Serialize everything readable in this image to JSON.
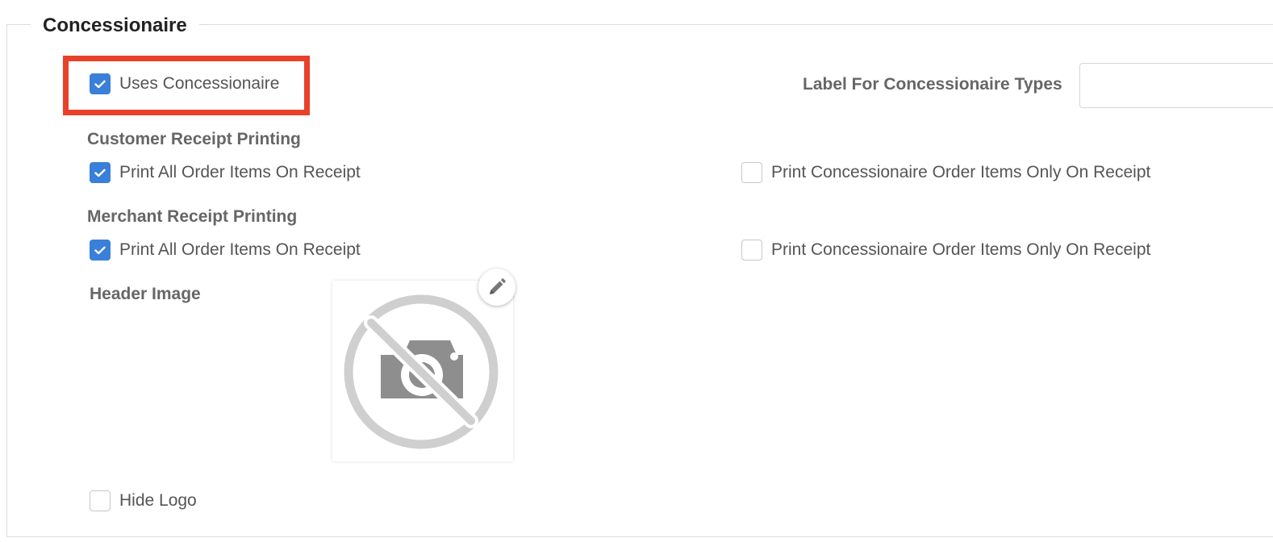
{
  "section": {
    "title": "Concessionaire"
  },
  "uses_concessionaire": {
    "label": "Uses Concessionaire",
    "checked": true
  },
  "label_types": {
    "label": "Label For Concessionaire Types",
    "value": ""
  },
  "customer_receipt": {
    "heading": "Customer Receipt Printing",
    "print_all": {
      "label": "Print All Order Items On Receipt",
      "checked": true
    },
    "print_concessionaire_only": {
      "label": "Print Concessionaire Order Items Only On Receipt",
      "checked": false
    }
  },
  "merchant_receipt": {
    "heading": "Merchant Receipt Printing",
    "print_all": {
      "label": "Print All Order Items On Receipt",
      "checked": true
    },
    "print_concessionaire_only": {
      "label": "Print Concessionaire Order Items Only On Receipt",
      "checked": false
    }
  },
  "header_image": {
    "label": "Header Image",
    "placeholder_icon": "no-camera-icon",
    "edit_icon": "pencil-icon"
  },
  "hide_logo": {
    "label": "Hide Logo",
    "checked": false
  },
  "colors": {
    "accent": "#3a7fd9",
    "highlight": "#e8412a"
  }
}
